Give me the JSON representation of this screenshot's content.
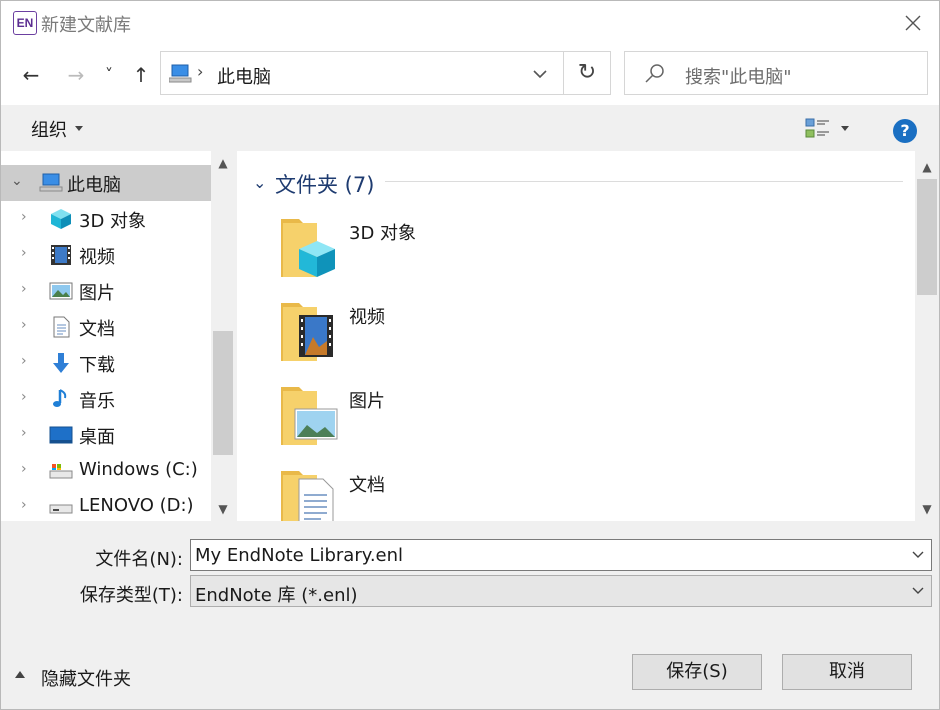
{
  "window": {
    "title": "新建文献库",
    "app_icon_text": "EN"
  },
  "nav": {
    "back": "←",
    "forward": "→",
    "recent": "˅",
    "up": "↑",
    "address": "此电脑",
    "refresh": "↻",
    "search_placeholder": "搜索\"此电脑\""
  },
  "toolbar": {
    "organize": "组织",
    "help": "?"
  },
  "tree": {
    "items": [
      {
        "label": "此电脑",
        "icon": "computer-icon",
        "selected": true
      },
      {
        "label": "3D 对象",
        "icon": "cube-3d-icon"
      },
      {
        "label": "视频",
        "icon": "video-icon"
      },
      {
        "label": "图片",
        "icon": "pictures-icon"
      },
      {
        "label": "文档",
        "icon": "documents-icon"
      },
      {
        "label": "下载",
        "icon": "download-arrow-icon"
      },
      {
        "label": "音乐",
        "icon": "music-note-icon"
      },
      {
        "label": "桌面",
        "icon": "desktop-icon"
      },
      {
        "label": "Windows (C:)",
        "icon": "drive-c-icon"
      },
      {
        "label": "LENOVO (D:)",
        "icon": "drive-d-icon"
      }
    ]
  },
  "content": {
    "group_title": "文件夹 (7)",
    "folders": [
      {
        "name": "3D 对象",
        "icon": "folder-3d-icon"
      },
      {
        "name": "视频",
        "icon": "folder-video-icon"
      },
      {
        "name": "图片",
        "icon": "folder-pictures-icon"
      },
      {
        "name": "文档",
        "icon": "folder-documents-icon"
      }
    ]
  },
  "form": {
    "filename_label": "文件名(N):",
    "filename_value": "My EndNote Library.enl",
    "filetype_label": "保存类型(T):",
    "filetype_value": "EndNote 库 (*.enl)"
  },
  "footer": {
    "hide_folders": "隐藏文件夹",
    "save": "保存(S)",
    "cancel": "取消"
  },
  "colors": {
    "accent": "#1a6fc2",
    "selected": "#cccccc",
    "group_title": "#1e3b70",
    "brand": "#5b2d91"
  }
}
